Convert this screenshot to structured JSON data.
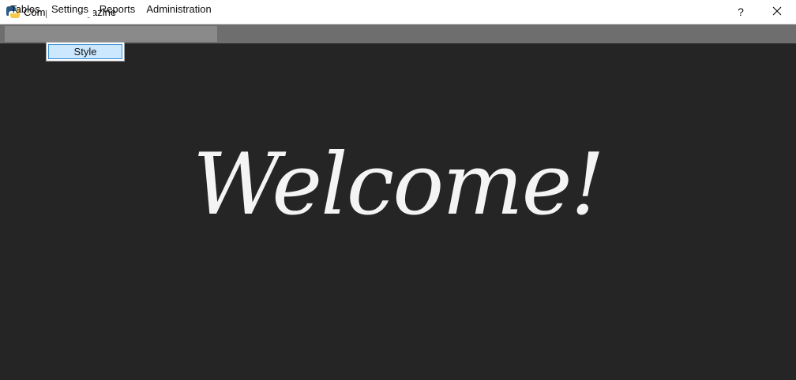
{
  "window": {
    "title": "Computer magazine",
    "icon": "python-icon",
    "help_label": "?",
    "close_label": "✕"
  },
  "menu": {
    "items": [
      {
        "label": "Tables"
      },
      {
        "label": "Settings",
        "active": true
      },
      {
        "label": "Reports"
      },
      {
        "label": "Administration"
      }
    ]
  },
  "dropdown": {
    "items": [
      {
        "label": "Style",
        "highlighted": true
      }
    ]
  },
  "main": {
    "welcome_text": "Welcome!"
  },
  "colors": {
    "background": "#252525",
    "menubar": "#6e6e6e",
    "highlight": "#cce8ff",
    "text_light": "#f4f4f4"
  }
}
